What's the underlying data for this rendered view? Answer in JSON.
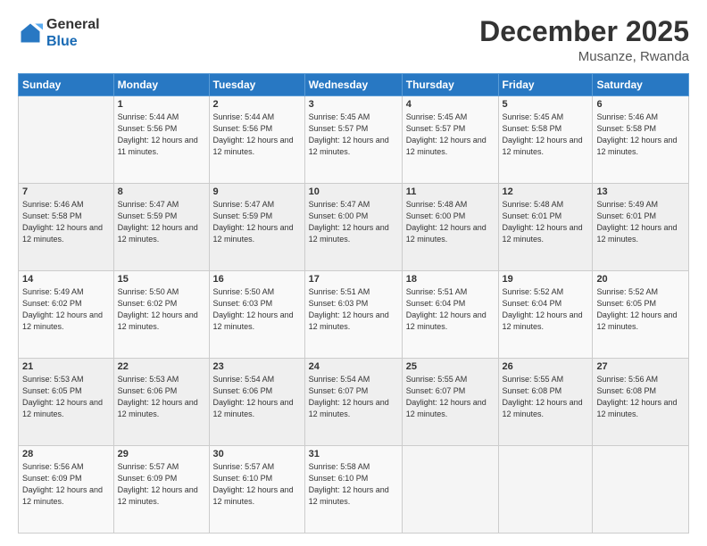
{
  "header": {
    "logo_line1": "General",
    "logo_line2": "Blue",
    "month": "December 2025",
    "location": "Musanze, Rwanda"
  },
  "days_of_week": [
    "Sunday",
    "Monday",
    "Tuesday",
    "Wednesday",
    "Thursday",
    "Friday",
    "Saturday"
  ],
  "weeks": [
    [
      {
        "day": "",
        "sunrise": "",
        "sunset": "",
        "daylight": ""
      },
      {
        "day": "1",
        "sunrise": "Sunrise: 5:44 AM",
        "sunset": "Sunset: 5:56 PM",
        "daylight": "Daylight: 12 hours and 11 minutes."
      },
      {
        "day": "2",
        "sunrise": "Sunrise: 5:44 AM",
        "sunset": "Sunset: 5:56 PM",
        "daylight": "Daylight: 12 hours and 12 minutes."
      },
      {
        "day": "3",
        "sunrise": "Sunrise: 5:45 AM",
        "sunset": "Sunset: 5:57 PM",
        "daylight": "Daylight: 12 hours and 12 minutes."
      },
      {
        "day": "4",
        "sunrise": "Sunrise: 5:45 AM",
        "sunset": "Sunset: 5:57 PM",
        "daylight": "Daylight: 12 hours and 12 minutes."
      },
      {
        "day": "5",
        "sunrise": "Sunrise: 5:45 AM",
        "sunset": "Sunset: 5:58 PM",
        "daylight": "Daylight: 12 hours and 12 minutes."
      },
      {
        "day": "6",
        "sunrise": "Sunrise: 5:46 AM",
        "sunset": "Sunset: 5:58 PM",
        "daylight": "Daylight: 12 hours and 12 minutes."
      }
    ],
    [
      {
        "day": "7",
        "sunrise": "Sunrise: 5:46 AM",
        "sunset": "Sunset: 5:58 PM",
        "daylight": "Daylight: 12 hours and 12 minutes."
      },
      {
        "day": "8",
        "sunrise": "Sunrise: 5:47 AM",
        "sunset": "Sunset: 5:59 PM",
        "daylight": "Daylight: 12 hours and 12 minutes."
      },
      {
        "day": "9",
        "sunrise": "Sunrise: 5:47 AM",
        "sunset": "Sunset: 5:59 PM",
        "daylight": "Daylight: 12 hours and 12 minutes."
      },
      {
        "day": "10",
        "sunrise": "Sunrise: 5:47 AM",
        "sunset": "Sunset: 6:00 PM",
        "daylight": "Daylight: 12 hours and 12 minutes."
      },
      {
        "day": "11",
        "sunrise": "Sunrise: 5:48 AM",
        "sunset": "Sunset: 6:00 PM",
        "daylight": "Daylight: 12 hours and 12 minutes."
      },
      {
        "day": "12",
        "sunrise": "Sunrise: 5:48 AM",
        "sunset": "Sunset: 6:01 PM",
        "daylight": "Daylight: 12 hours and 12 minutes."
      },
      {
        "day": "13",
        "sunrise": "Sunrise: 5:49 AM",
        "sunset": "Sunset: 6:01 PM",
        "daylight": "Daylight: 12 hours and 12 minutes."
      }
    ],
    [
      {
        "day": "14",
        "sunrise": "Sunrise: 5:49 AM",
        "sunset": "Sunset: 6:02 PM",
        "daylight": "Daylight: 12 hours and 12 minutes."
      },
      {
        "day": "15",
        "sunrise": "Sunrise: 5:50 AM",
        "sunset": "Sunset: 6:02 PM",
        "daylight": "Daylight: 12 hours and 12 minutes."
      },
      {
        "day": "16",
        "sunrise": "Sunrise: 5:50 AM",
        "sunset": "Sunset: 6:03 PM",
        "daylight": "Daylight: 12 hours and 12 minutes."
      },
      {
        "day": "17",
        "sunrise": "Sunrise: 5:51 AM",
        "sunset": "Sunset: 6:03 PM",
        "daylight": "Daylight: 12 hours and 12 minutes."
      },
      {
        "day": "18",
        "sunrise": "Sunrise: 5:51 AM",
        "sunset": "Sunset: 6:04 PM",
        "daylight": "Daylight: 12 hours and 12 minutes."
      },
      {
        "day": "19",
        "sunrise": "Sunrise: 5:52 AM",
        "sunset": "Sunset: 6:04 PM",
        "daylight": "Daylight: 12 hours and 12 minutes."
      },
      {
        "day": "20",
        "sunrise": "Sunrise: 5:52 AM",
        "sunset": "Sunset: 6:05 PM",
        "daylight": "Daylight: 12 hours and 12 minutes."
      }
    ],
    [
      {
        "day": "21",
        "sunrise": "Sunrise: 5:53 AM",
        "sunset": "Sunset: 6:05 PM",
        "daylight": "Daylight: 12 hours and 12 minutes."
      },
      {
        "day": "22",
        "sunrise": "Sunrise: 5:53 AM",
        "sunset": "Sunset: 6:06 PM",
        "daylight": "Daylight: 12 hours and 12 minutes."
      },
      {
        "day": "23",
        "sunrise": "Sunrise: 5:54 AM",
        "sunset": "Sunset: 6:06 PM",
        "daylight": "Daylight: 12 hours and 12 minutes."
      },
      {
        "day": "24",
        "sunrise": "Sunrise: 5:54 AM",
        "sunset": "Sunset: 6:07 PM",
        "daylight": "Daylight: 12 hours and 12 minutes."
      },
      {
        "day": "25",
        "sunrise": "Sunrise: 5:55 AM",
        "sunset": "Sunset: 6:07 PM",
        "daylight": "Daylight: 12 hours and 12 minutes."
      },
      {
        "day": "26",
        "sunrise": "Sunrise: 5:55 AM",
        "sunset": "Sunset: 6:08 PM",
        "daylight": "Daylight: 12 hours and 12 minutes."
      },
      {
        "day": "27",
        "sunrise": "Sunrise: 5:56 AM",
        "sunset": "Sunset: 6:08 PM",
        "daylight": "Daylight: 12 hours and 12 minutes."
      }
    ],
    [
      {
        "day": "28",
        "sunrise": "Sunrise: 5:56 AM",
        "sunset": "Sunset: 6:09 PM",
        "daylight": "Daylight: 12 hours and 12 minutes."
      },
      {
        "day": "29",
        "sunrise": "Sunrise: 5:57 AM",
        "sunset": "Sunset: 6:09 PM",
        "daylight": "Daylight: 12 hours and 12 minutes."
      },
      {
        "day": "30",
        "sunrise": "Sunrise: 5:57 AM",
        "sunset": "Sunset: 6:10 PM",
        "daylight": "Daylight: 12 hours and 12 minutes."
      },
      {
        "day": "31",
        "sunrise": "Sunrise: 5:58 AM",
        "sunset": "Sunset: 6:10 PM",
        "daylight": "Daylight: 12 hours and 12 minutes."
      },
      {
        "day": "",
        "sunrise": "",
        "sunset": "",
        "daylight": ""
      },
      {
        "day": "",
        "sunrise": "",
        "sunset": "",
        "daylight": ""
      },
      {
        "day": "",
        "sunrise": "",
        "sunset": "",
        "daylight": ""
      }
    ]
  ]
}
